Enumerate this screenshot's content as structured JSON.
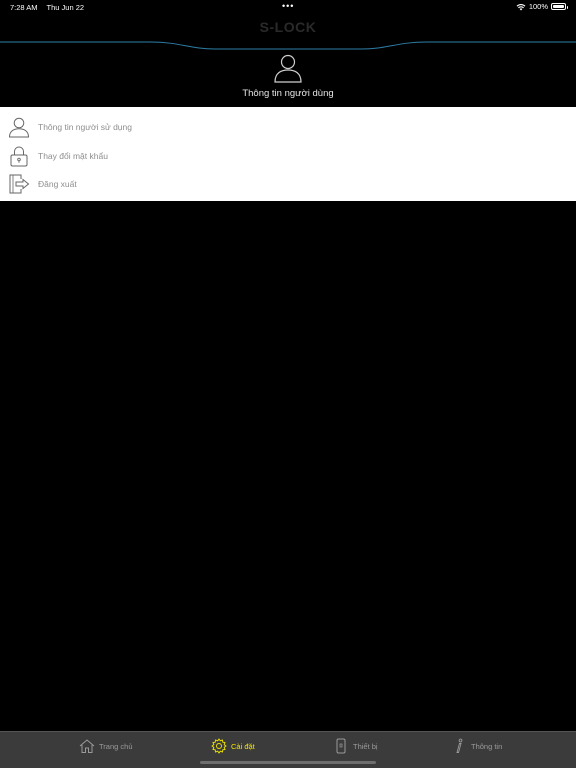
{
  "status_bar": {
    "time": "7:28 AM",
    "date": "Thu Jun 22",
    "dots": "•••",
    "battery_text": "100%",
    "battery_level": 1.0
  },
  "header": {
    "app_title": "S-LOCK",
    "caption": "Thông tin người dùng",
    "icon": "user-icon"
  },
  "menu": {
    "items": [
      {
        "label": "Thông tin người sử dụng",
        "icon": "user-icon"
      },
      {
        "label": "Thay đổi mật khẩu",
        "icon": "lock-icon"
      },
      {
        "label": "Đăng xuất",
        "icon": "logout-icon"
      }
    ]
  },
  "tab_bar": {
    "active_color": "#f2e600",
    "tabs": [
      {
        "label": "Trang chủ",
        "icon": "home-icon"
      },
      {
        "label": "Cài đặt",
        "icon": "gear-icon",
        "active": true
      },
      {
        "label": "Thiết bị",
        "icon": "device-icon"
      },
      {
        "label": "Thông tin",
        "icon": "info-icon"
      }
    ]
  },
  "colors": {
    "background": "#000000",
    "menu_background": "#ffffff",
    "tab_bar_background": "#3b3b3b",
    "header_line": "#2e7fa8"
  }
}
